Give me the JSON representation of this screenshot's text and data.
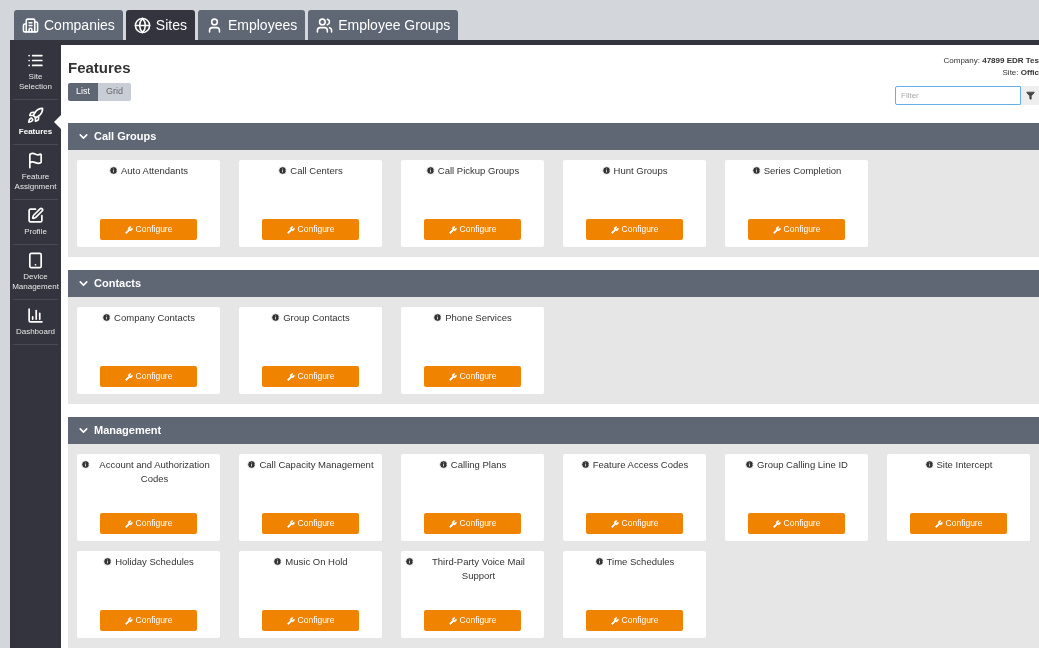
{
  "tabs": [
    {
      "label": "Companies",
      "selected": false
    },
    {
      "label": "Sites",
      "selected": true
    },
    {
      "label": "Employees",
      "selected": false
    },
    {
      "label": "Employee Groups",
      "selected": false
    }
  ],
  "sidebar": {
    "items": [
      {
        "label": "Site Selection",
        "selected": false
      },
      {
        "label": "Features",
        "selected": true
      },
      {
        "label": "Feature Assignment",
        "selected": false
      },
      {
        "label": "Profile",
        "selected": false
      },
      {
        "label": "Device Management",
        "selected": false
      },
      {
        "label": "Dashboard",
        "selected": false
      }
    ]
  },
  "page_title": "Features",
  "view_toggle": [
    {
      "label": "List",
      "selected": true
    },
    {
      "label": "Grid",
      "selected": false
    }
  ],
  "context": {
    "company_label": "Company:",
    "company_value": "47899 EDR Tes",
    "site_label": "Site:",
    "site_value": "Offic"
  },
  "filter": {
    "placeholder": "Filter"
  },
  "sections": [
    {
      "title": "Call Groups",
      "expanded": true,
      "cards": [
        {
          "title": "Auto Attendants",
          "button": "Configure"
        },
        {
          "title": "Call Centers",
          "button": "Configure"
        },
        {
          "title": "Call Pickup Groups",
          "button": "Configure"
        },
        {
          "title": "Hunt Groups",
          "button": "Configure"
        },
        {
          "title": "Series Completion",
          "button": "Configure"
        }
      ]
    },
    {
      "title": "Contacts",
      "expanded": true,
      "cards": [
        {
          "title": "Company Contacts",
          "button": "Configure"
        },
        {
          "title": "Group Contacts",
          "button": "Configure"
        },
        {
          "title": "Phone Services",
          "button": "Configure"
        }
      ]
    },
    {
      "title": "Management",
      "expanded": true,
      "cards": [
        {
          "title": "Account and Authorization Codes",
          "button": "Configure"
        },
        {
          "title": "Call Capacity Management",
          "button": "Configure"
        },
        {
          "title": "Calling Plans",
          "button": "Configure"
        },
        {
          "title": "Feature Access Codes",
          "button": "Configure"
        },
        {
          "title": "Group Calling Line ID",
          "button": "Configure"
        },
        {
          "title": "Site Intercept",
          "button": "Configure"
        },
        {
          "title": "Holiday Schedules",
          "button": "Configure"
        },
        {
          "title": "Music On Hold",
          "button": "Configure"
        },
        {
          "title": "Third-Party Voice Mail Support",
          "button": "Configure"
        },
        {
          "title": "Time Schedules",
          "button": "Configure"
        }
      ]
    }
  ]
}
